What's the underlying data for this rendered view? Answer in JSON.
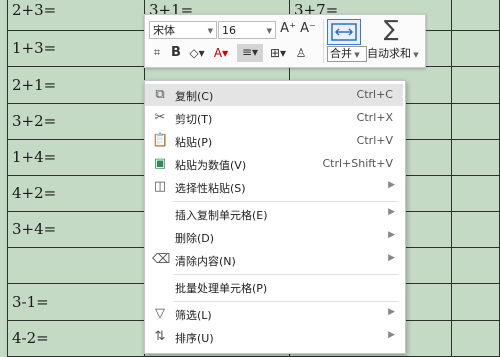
{
  "sheet": {
    "col_a": [
      "2+3=",
      "1+3=",
      "2+1=",
      "3+2=",
      "1+4=",
      "4+2=",
      "3+4=",
      "",
      "3-1=",
      "4-2="
    ],
    "col_b_top": "3+1=",
    "col_c_top": "3+7="
  },
  "toolbar": {
    "font_name": "宋体",
    "font_size": "16",
    "grow_font": "A⁺",
    "shrink_font": "A⁻",
    "merge_label": "合并",
    "sum_label": "自动求和"
  },
  "menu": {
    "items": [
      {
        "label": "复制(C)",
        "shortcut": "Ctrl+C",
        "icon": "copy-icon",
        "glyph": "⧉"
      },
      {
        "label": "剪切(T)",
        "shortcut": "Ctrl+X",
        "icon": "scissors-icon",
        "glyph": "✂"
      },
      {
        "label": "粘贴(P)",
        "shortcut": "Ctrl+V",
        "icon": "paste-icon",
        "glyph": "📋"
      },
      {
        "label": "粘贴为数值(V)",
        "shortcut": "Ctrl+Shift+V",
        "icon": "paste-values-icon",
        "glyph": "▣"
      },
      {
        "label": "选择性粘贴(S)",
        "shortcut": "",
        "icon": "paste-special-icon",
        "glyph": "◫"
      },
      {
        "label": "插入复制单元格(E)",
        "shortcut": "",
        "icon": "",
        "glyph": ""
      },
      {
        "label": "删除(D)",
        "shortcut": "",
        "icon": "",
        "glyph": ""
      },
      {
        "label": "清除内容(N)",
        "shortcut": "",
        "icon": "eraser-icon",
        "glyph": "⌫"
      },
      {
        "label": "批量处理单元格(P)",
        "shortcut": "",
        "icon": "",
        "glyph": ""
      },
      {
        "label": "筛选(L)",
        "shortcut": "",
        "icon": "filter-icon",
        "glyph": "▽"
      },
      {
        "label": "排序(U)",
        "shortcut": "",
        "icon": "sort-icon",
        "glyph": "⇅"
      }
    ]
  }
}
